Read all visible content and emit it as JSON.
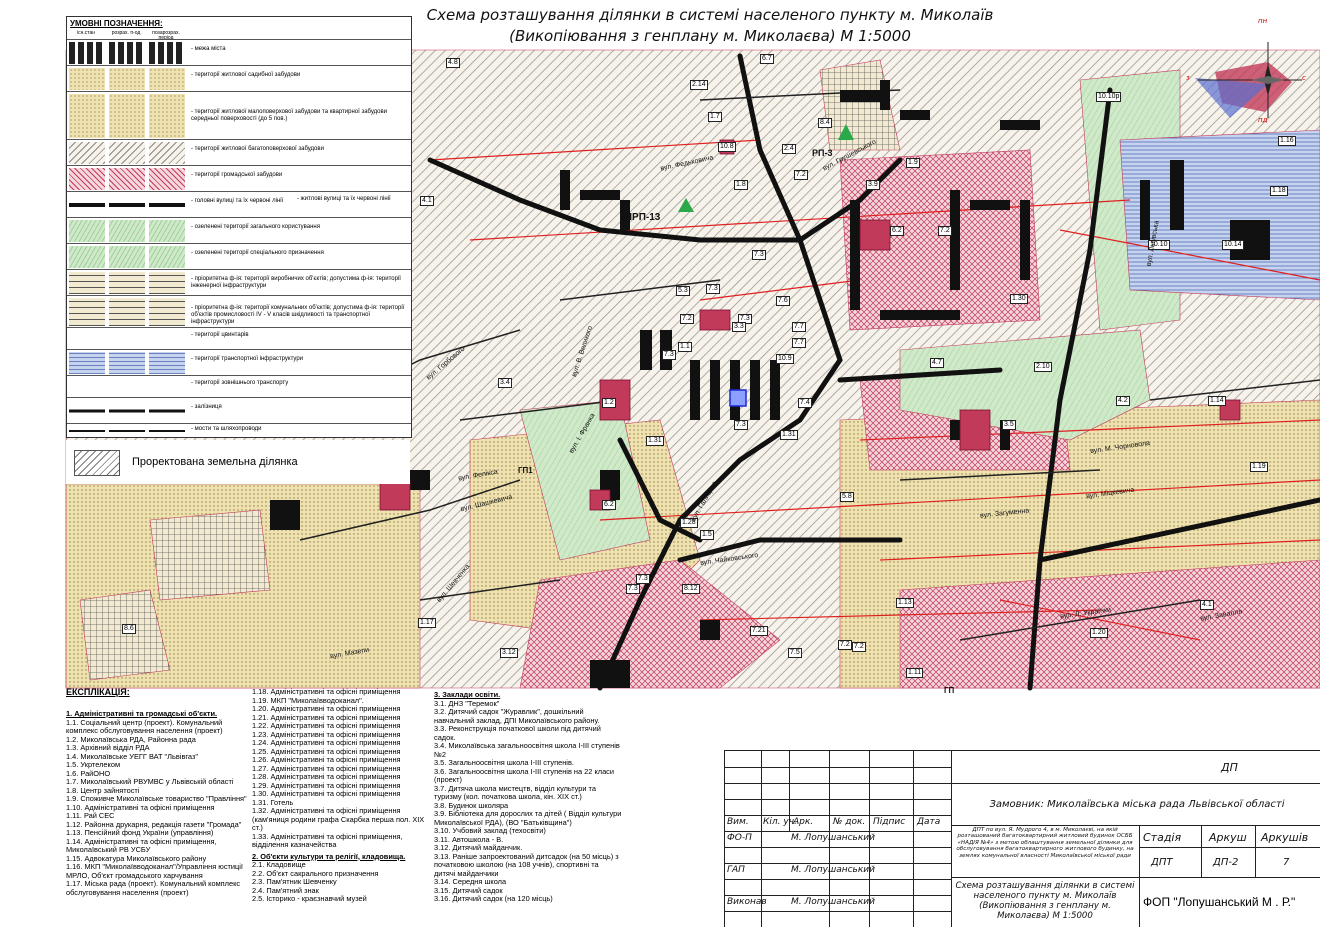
{
  "title": {
    "line1": "Схема розташування ділянки в системі населеного пункту м. Миколаїв",
    "line2": "(Викопіювання з генплану м. Миколаєва) М 1:5000"
  },
  "legend": {
    "heading": "УМОВНІ ПОЗНАЧЕННЯ:",
    "col_existing": "існ.стан",
    "col_calc": "розрах. п-од",
    "col_beyond": "позарозрах. період",
    "items": [
      "- межа міста",
      "- території житлової садибної забудови",
      "- території житлової малоповерхової забудови та квартирної забудови середньої поверховості (до 5 пов.)",
      "- території житлової багатоповерхової забудови",
      "- території громадської забудови",
      "- головні вулиці та їх червоні лінії",
      "- житлові вулиці та їх червоні лінії",
      "- озеленені території загального користування",
      "- озеленені території спеціального призначення",
      "- пріоритетна ф-ія: території виробничих об'єктів; допустима ф-ія: території інженерної інфраструктури",
      "- пріоритетна ф-ія: території комунальних об'єктів; допустима ф-ія: території об'єктів промисловості IV - V класів шкідливості та транспортної інфраструктури",
      "- території цвинтарів",
      "- території транспортної інфраструктури",
      "- території зовнішнього транспорту",
      "- залізниця",
      "- мости та шляхопроводи"
    ],
    "projected": "Проректована земельна ділянка"
  },
  "compass": {
    "n": "пн",
    "s": "пд",
    "w": "з",
    "e": "с"
  },
  "map": {
    "zones": [
      "ШРП-13",
      "РП-3",
      "ГП1",
      "ГП"
    ],
    "labels": [
      "4.8",
      "2.14",
      "6.7",
      "1.7",
      "4.1",
      "10.10р",
      "1.16",
      "1.8",
      "10.8",
      "8.4",
      "2.4",
      "1.9",
      "7.2",
      "10.10",
      "1.18",
      "10.14",
      "1.31",
      "3.9",
      "6.2",
      "7.2",
      "1.30",
      "7.3",
      "5.3",
      "7.3",
      "7.6",
      "7.3",
      "3.3",
      "7.7",
      "7.2",
      "1.1",
      "7.7",
      "10.9",
      "7.4",
      "4.7",
      "2.10",
      "3.4",
      "1.2",
      "7.3",
      "7.3",
      "1.31",
      "3.5",
      "4.2",
      "1.14",
      "1.19",
      "6.2",
      "5.8",
      "1.28",
      "1.5",
      "7.3",
      "8.12",
      "7.3",
      "1.13",
      "7.21",
      "7.5",
      "7.2",
      "1.20",
      "1.17",
      "3.12",
      "8.6",
      "1.11",
      "4.1",
      "7.2"
    ],
    "streets": [
      "вул. Федьковича",
      "вул. Грушевського",
      "вул. Горбового",
      "вул. В. Великого",
      "вул. М. Чорновола",
      "вул. Міцкевича",
      "вул. Чайковського",
      "вул. Загуменна",
      "вул. Шевченка",
      "вул. Мазепи",
      "вул. Львівська",
      "вул. Мурова",
      "вул. Л. Українки",
      "вул. Завалля",
      "вул. Галицька",
      "вул. Шашкевича",
      "вул. Фелікса",
      "вул. І. Франка"
    ]
  },
  "explication": {
    "heading": "ЕКСПЛІКАЦІЯ:",
    "col1": [
      {
        "t": "1. Адміністративні та громадські об'єкти.",
        "h": true
      },
      {
        "t": "1.1. Соціальний центр (проект). Комунальний комплекс обслуговування населення (проект)"
      },
      {
        "t": "1.2. Миколаївська РДА, Районна рада"
      },
      {
        "t": "1.3. Архівний відділ РДА"
      },
      {
        "t": "1.4. Миколаївське УЕГГ ВАТ \"Львівгаз\""
      },
      {
        "t": "1.5. Укртелеком"
      },
      {
        "t": "1.6. РайОНО"
      },
      {
        "t": "1.7. Миколаївський РВУМВС у Львівській області"
      },
      {
        "t": "1.8. Центр зайнятості"
      },
      {
        "t": "1.9. Споживче Миколаївське товариство \"Правління\""
      },
      {
        "t": "1.10. Адміністративні та офісні приміщення"
      },
      {
        "t": "1.11. Рай СЕС"
      },
      {
        "t": "1.12. Районна друкарня, редакція газети \"Громада\""
      },
      {
        "t": "1.13. Пенсійний фонд України (управління)"
      },
      {
        "t": "1.14. Адміністративні та офісні приміщення, Миколаївський РВ УСБУ"
      },
      {
        "t": "1.15. Адвокатура Миколаївського району"
      },
      {
        "t": "1.16. МКП \"Миколаївводоканал\"/Управління юстиції МРЛО, Об'єкт громадського харчування"
      },
      {
        "t": "1.17. Міська рада (проект). Комунальний комплекс обслуговування населення (проект)"
      }
    ],
    "col2": [
      {
        "t": "1.18. Адміністративні та офісні приміщення"
      },
      {
        "t": "1.19. МКП \"Миколаївводоканал\"."
      },
      {
        "t": "1.20. Адміністративні та офісні приміщення"
      },
      {
        "t": "1.21. Адміністративні та офісні приміщення"
      },
      {
        "t": "1.22. Адміністративні та офісні приміщення"
      },
      {
        "t": "1.23. Адміністративні та офісні приміщення"
      },
      {
        "t": "1.24. Адміністративні та офісні приміщення"
      },
      {
        "t": "1.25. Адміністративні та офісні приміщення"
      },
      {
        "t": "1.26. Адміністративні та офісні приміщення"
      },
      {
        "t": "1.27. Адміністративні та офісні приміщення"
      },
      {
        "t": "1.28. Адміністративні та офісні приміщення"
      },
      {
        "t": "1.29. Адміністративні та офісні приміщення"
      },
      {
        "t": "1.30. Адміністративні та офісні приміщення"
      },
      {
        "t": "1.31. Готель"
      },
      {
        "t": "1.32. Адміністративні та офісні приміщення (кам'яниця родини графа Скарбка перша пол. XIX ст.)"
      },
      {
        "t": "1.33. Адміністративні та офісні приміщення, відділення казначейства"
      },
      {
        "t": "2. Об'єкти культури та релігії, кладовища.",
        "h": true
      },
      {
        "t": "2.1. Кладовище"
      },
      {
        "t": "2.2. Об'єкт сакрального призначення"
      },
      {
        "t": "2.3. Пам'ятник Шевченку"
      },
      {
        "t": "2.4. Пам'ятний знак"
      },
      {
        "t": "2.5. Історико - краєзнавчий музей"
      }
    ],
    "col3": [
      {
        "t": "3. Заклади освіти.",
        "h": true
      },
      {
        "t": "3.1. ДНЗ \"Теремок\""
      },
      {
        "t": "3.2. Дитячий садок \"Журавлик\", дошкільний навчальний заклад, ДПІ Миколаївського району."
      },
      {
        "t": "3.3. Реконструкція початкової школи під дитячий садок."
      },
      {
        "t": "3.4. Миколаївська загальноосвітня школа І-ІІІ ступенів №2"
      },
      {
        "t": "3.5. Загальноосвітня школа І-ІІІ ступенів."
      },
      {
        "t": "3.6. Загальноосвітня школа І-ІІІ ступенів на 22 класи (проект)"
      },
      {
        "t": "3.7. Дитяча школа мистецтв, відділ культури та туризму (кол. початкова школа, кін. XIX ст.)"
      },
      {
        "t": "3.8. Будинок школяра"
      },
      {
        "t": "3.9. Бібліотека для дорослих та дітей ( Відділ культури Миколаївської РДА), (ВО \"Батьківщина\")"
      },
      {
        "t": "3.10. Учбовий заклад (техосвіти)"
      },
      {
        "t": "3.11. Автошкола - В."
      },
      {
        "t": "3.12. Дитячий майданчик."
      },
      {
        "t": "3.13. Раніше запроектований дитсадок (на 50 місць) з початковою школою (на 108 учнів), спортивні та дитячі майданчики"
      },
      {
        "t": "3.14. Середня школа"
      },
      {
        "t": "3.15. Дитячий садок"
      },
      {
        "t": "3.16. Дитячий садок (на 120 місць)"
      }
    ]
  },
  "stamp": {
    "code": "ДП",
    "customer": "Замовник: Миколаївська міська рада Львівської області",
    "headers": {
      "vim": "Вим.",
      "kil": "Кіл. уч.",
      "ark": "Арк.",
      "doc": "№ док.",
      "sign": "Підпис",
      "date": "Дата"
    },
    "project_desc": "ДПТ по вул. Я. Мудрого 4, в м. Миколаєві, на якій розташований багатоквартирний житловий будинок ОСББ «НАДІЯ №4» з метою облаштування земельної ділянки для обслуговування багатоквартирного житлового будинку, на землях комунальної власності Миколаївської міської ради",
    "rows": [
      {
        "role": "ФО-П",
        "name": "М. Лопушанський"
      },
      {
        "role": "ГАП",
        "name": "М. Лопушанський"
      },
      {
        "role": "Виконав",
        "name": "М. Лопушанський"
      }
    ],
    "stage_label": "Стадія",
    "sheet_label": "Аркуш",
    "sheets_label": "Аркушів",
    "stage": "ДПТ",
    "sheet": "ДП-2",
    "sheets": "7",
    "drawing_title": "Схема розташування ділянки в системі населеного пункту м. Миколаїв (Викопіювання з генплану м. Миколаєва) М 1:5000",
    "company": "ФОП \"Лопушанський М . Р.\""
  },
  "colors": {
    "residential_low": "#efe2b0",
    "public": "#c23a5a",
    "green": "#bfe3c0",
    "red_line": "#e02020",
    "transport": "#b7c7e6",
    "road": "#111111"
  }
}
